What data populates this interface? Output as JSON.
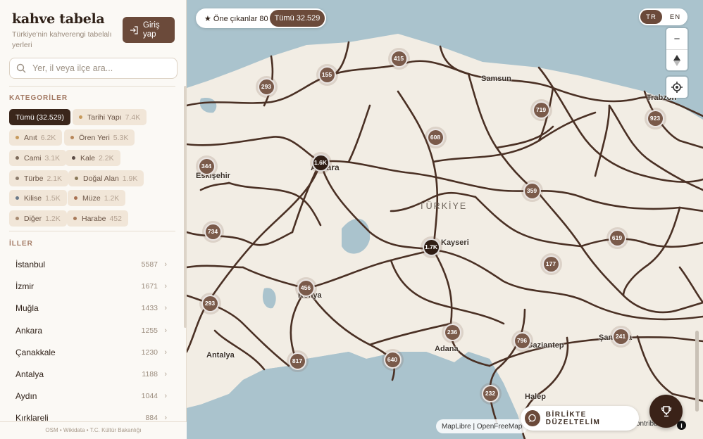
{
  "brand": {
    "title": "kahve tabela",
    "subtitle": "Türkiye'nin kahverengi tabelalı yerleri",
    "login_label": "Giriş yap"
  },
  "search": {
    "placeholder": "Yer, il veya ilçe ara..."
  },
  "categories": {
    "heading": "KATEGORİLER",
    "items": [
      {
        "label": "Tümü (32.529)",
        "count": "",
        "active": true,
        "dot": ""
      },
      {
        "label": "Tarihi Yapı",
        "count": "7.4K",
        "dot": "#c79a5c"
      },
      {
        "label": "Anıt",
        "count": "6.2K",
        "dot": "#c79a5c"
      },
      {
        "label": "Ören Yeri",
        "count": "5.3K",
        "dot": "#b8875a"
      },
      {
        "label": "Cami",
        "count": "3.1K",
        "dot": "#7d6a5a"
      },
      {
        "label": "Kale",
        "count": "2.2K",
        "dot": "#5a4a44"
      },
      {
        "label": "Türbe",
        "count": "2.1K",
        "dot": "#8b7a6a"
      },
      {
        "label": "Doğal Alan",
        "count": "1.9K",
        "dot": "#8a7a5a"
      },
      {
        "label": "Kilise",
        "count": "1.5K",
        "dot": "#6a7a8a"
      },
      {
        "label": "Müze",
        "count": "1.2K",
        "dot": "#a87050"
      },
      {
        "label": "Diğer",
        "count": "1.2K",
        "dot": "#a88a70"
      },
      {
        "label": "Harabe",
        "count": "452",
        "dot": "#a87a5a"
      }
    ]
  },
  "provinces": {
    "heading": "İLLER",
    "items": [
      {
        "name": "İstanbul",
        "count": "5587"
      },
      {
        "name": "İzmir",
        "count": "1671"
      },
      {
        "name": "Muğla",
        "count": "1433"
      },
      {
        "name": "Ankara",
        "count": "1255"
      },
      {
        "name": "Çanakkale",
        "count": "1230"
      },
      {
        "name": "Antalya",
        "count": "1188"
      },
      {
        "name": "Aydın",
        "count": "1044"
      },
      {
        "name": "Kırklareli",
        "count": "884"
      }
    ]
  },
  "footer": "OSM • Wikidata • T.C. Kültür Bakanlığı",
  "toolbar": {
    "featured_label": "★ Öne çıkanlar 80",
    "all_label": "Tümü 32.529"
  },
  "lang": {
    "tr": "TR",
    "en": "EN"
  },
  "zoom": {
    "in": "+",
    "out": "−"
  },
  "map": {
    "country": "TÜRKİYE",
    "cities": [
      {
        "name": "Samsun"
      },
      {
        "name": "Trabzon"
      },
      {
        "name": "Eskişehir"
      },
      {
        "name": "Ankara"
      },
      {
        "name": "Kayseri"
      },
      {
        "name": "Konya"
      },
      {
        "name": "Antalya"
      },
      {
        "name": "Adana"
      },
      {
        "name": "Gaziantep"
      },
      {
        "name": "Şanlıurfa"
      },
      {
        "name": "Halep"
      }
    ],
    "clusters": [
      {
        "label": "415"
      },
      {
        "label": "155"
      },
      {
        "label": "293"
      },
      {
        "label": "719"
      },
      {
        "label": "923"
      },
      {
        "label": "608"
      },
      {
        "label": "344"
      },
      {
        "label": "1.6K"
      },
      {
        "label": "359"
      },
      {
        "label": "734"
      },
      {
        "label": "1.7K"
      },
      {
        "label": "619"
      },
      {
        "label": "177"
      },
      {
        "label": "456"
      },
      {
        "label": "293"
      },
      {
        "label": "236"
      },
      {
        "label": "796"
      },
      {
        "label": "241"
      },
      {
        "label": "817"
      },
      {
        "label": "640"
      },
      {
        "label": "232"
      }
    ]
  },
  "attribution": {
    "main": "MapLibre | OpenFreeMap",
    "tail": "contributors"
  },
  "together_label": "BİRLİKTE DÜZELTELİM"
}
